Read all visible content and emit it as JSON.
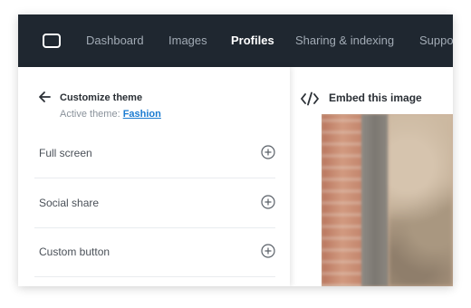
{
  "nav": {
    "items": [
      {
        "label": "Dashboard",
        "active": false
      },
      {
        "label": "Images",
        "active": false
      },
      {
        "label": "Profiles",
        "active": true
      },
      {
        "label": "Sharing & indexing",
        "active": false
      },
      {
        "label": "Suppo",
        "active": false
      }
    ]
  },
  "sidebar": {
    "title": "Customize theme",
    "active_theme_label": "Active theme:",
    "active_theme_value": "Fashion",
    "options": [
      {
        "label": "Full screen"
      },
      {
        "label": "Social share"
      },
      {
        "label": "Custom button"
      }
    ]
  },
  "embed": {
    "label": "Embed this image"
  },
  "colors": {
    "nav_bg": "#1f2730",
    "link": "#1a7bd1"
  }
}
